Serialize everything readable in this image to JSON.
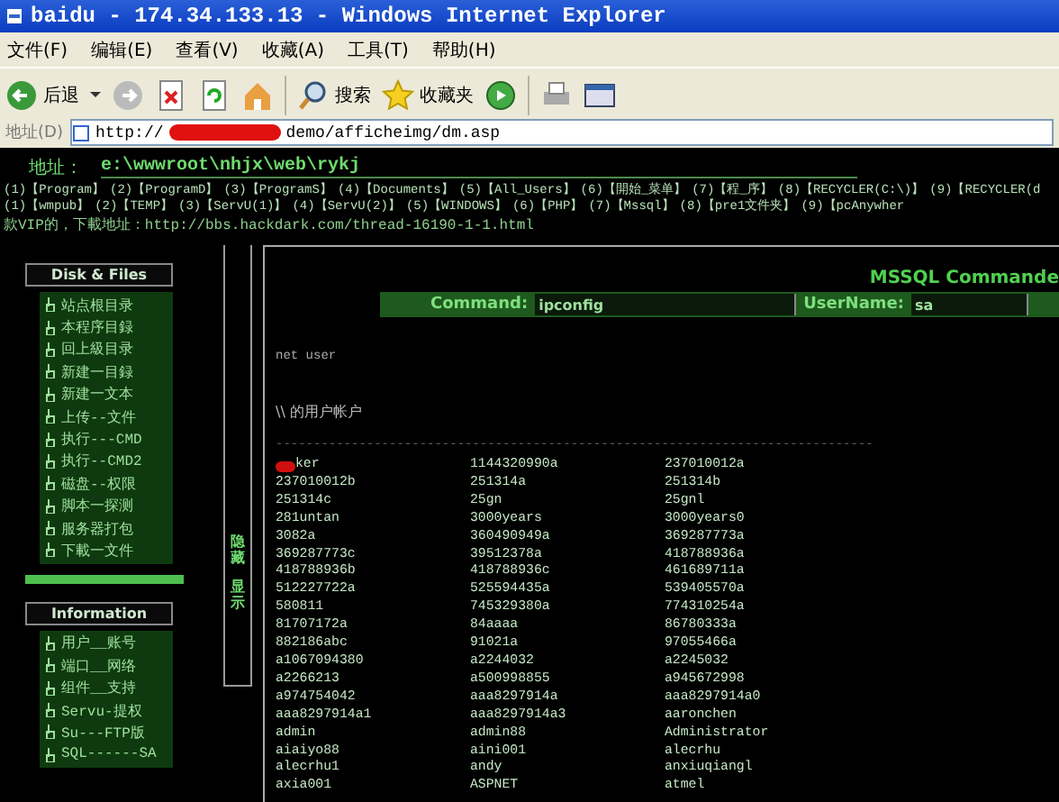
{
  "window": {
    "title": "baidu - 174.34.133.13 - Windows Internet Explorer"
  },
  "menu": [
    "文件(F)",
    "编辑(E)",
    "查看(V)",
    "收藏(A)",
    "工具(T)",
    "帮助(H)"
  ],
  "toolbar": {
    "back": "后退",
    "search": "搜索",
    "favorites": "收藏夹"
  },
  "address_bar": {
    "label": "地址(D)",
    "url_start": "http://",
    "url_end": "demo/afficheimg/dm.asp"
  },
  "shell": {
    "path_label": "地址：",
    "path": "e:\\wwwroot\\nhjx\\web\\rykj",
    "drive_rows": [
      [
        "(1)【Program】",
        "(2)【ProgramD】",
        "(3)【ProgramS】",
        "(4)【Documents】",
        "(5)【All_Users】",
        "(6)【開始_菜单】",
        "(7)【程_序】",
        "(8)【RECYCLER(C:\\)】",
        "(9)【RECYCLER(d"
      ],
      [
        "(1)【wmpub】",
        "(2)【TEMP】",
        "(3)【ServU(1)】",
        "(4)【ServU(2)】",
        "(5)【WINDOWS】",
        "(6)【PHP】",
        "(7)【Mssql】",
        "(8)【pre1文件夹】",
        "(9)【pcAnywher"
      ]
    ],
    "notice": "款VIP的，下載地址：http://bbs.hackdark.com/thread-16190-1-1.html"
  },
  "sidebar": {
    "sections": [
      {
        "title": "Disk & Files",
        "items": [
          "站点根目录",
          "本程序目録",
          "回上級目录",
          "新建一目録",
          "新建一文本",
          "上传--文件",
          "执行---CMD",
          "执行--CMD2",
          "磁盘--权限",
          "脚本一探测",
          "服务器打包",
          "下載一文件"
        ]
      },
      {
        "title": "Information",
        "items": [
          "用户__账号",
          "端口__网络",
          "组件__支持",
          "Servu-提权",
          "Su---FTP版",
          "SQL------SA"
        ]
      }
    ],
    "toggle": [
      "隐藏",
      "显示"
    ]
  },
  "main": {
    "title": "MSSQL Commande",
    "command_label": "Command:",
    "command": "ipconfig",
    "user_label": "UserName:",
    "user": "sa",
    "output_command": "net user",
    "output_heading": "\\\\ 的用户帐户",
    "separator": "-------------------------------------------------------------------------------",
    "accounts": [
      [
        "ker",
        "1144320990a",
        "237010012a"
      ],
      [
        "237010012b",
        "251314a",
        "251314b"
      ],
      [
        "251314c",
        "25gn",
        "25gnl"
      ],
      [
        "281untan",
        "3000years",
        "3000years0"
      ],
      [
        "3082a",
        "360490949a",
        "369287773a"
      ],
      [
        "369287773c",
        "39512378a",
        "418788936a"
      ],
      [
        "418788936b",
        "418788936c",
        "461689711a"
      ],
      [
        "512227722a",
        "525594435a",
        "539405570a"
      ],
      [
        "580811",
        "745329380a",
        "774310254a"
      ],
      [
        "81707172a",
        "84aaaa",
        "86780333a"
      ],
      [
        "882186abc",
        "91021a",
        "97055466a"
      ],
      [
        "a1067094380",
        "a2244032",
        "a2245032"
      ],
      [
        "a2266213",
        "a500998855",
        "a945672998"
      ],
      [
        "a974754042",
        "aaa8297914a",
        "aaa8297914a0"
      ],
      [
        "aaa8297914a1",
        "aaa8297914a3",
        "aaronchen"
      ],
      [
        "admin",
        "admin88",
        "Administrator"
      ],
      [
        "aiaiyo88",
        "aini001",
        "alecrhu"
      ],
      [
        "alecrhu1",
        "andy",
        "anxiuqiangl"
      ],
      [
        "axia001",
        "ASPNET",
        "atmel"
      ]
    ]
  }
}
